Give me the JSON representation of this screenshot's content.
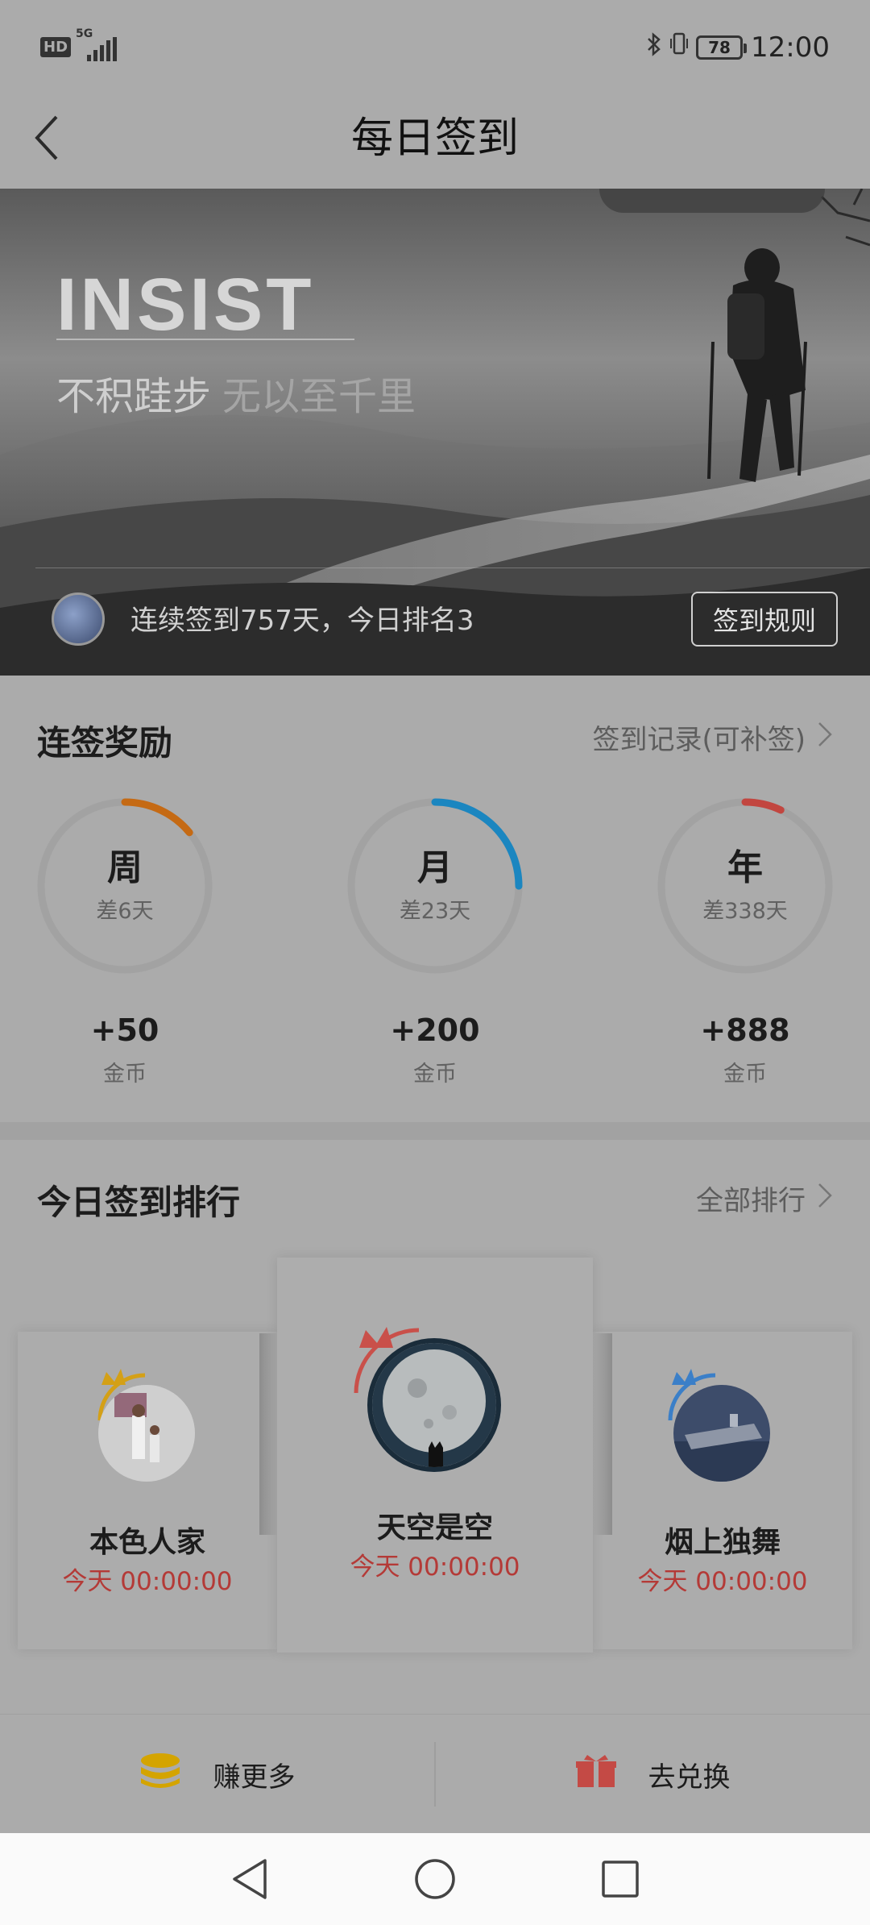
{
  "status_bar": {
    "hd": "HD",
    "network": "5G",
    "battery": "78",
    "time": "12:00"
  },
  "header": {
    "title": "每日签到"
  },
  "banner": {
    "headline": "INSIST",
    "slogan_main": "不积跬步",
    "slogan_rest": "无以至千里",
    "streak_text": "连续签到757天，今日排名3",
    "rules_button": "签到规则"
  },
  "rewards": {
    "title": "连签奖励",
    "link": "签到记录(可补签)",
    "items": [
      {
        "label": "周",
        "remaining": "差6天",
        "amount": "+50",
        "unit": "金币",
        "progress": 0.14,
        "color": "#c56a14"
      },
      {
        "label": "月",
        "remaining": "差23天",
        "amount": "+200",
        "unit": "金币",
        "progress": 0.25,
        "color": "#1b86c0"
      },
      {
        "label": "年",
        "remaining": "差338天",
        "amount": "+888",
        "unit": "金币",
        "progress": 0.07,
        "color": "#c24640"
      }
    ]
  },
  "ranking": {
    "title": "今日签到排行",
    "link": "全部排行",
    "entries": [
      {
        "rank": 2,
        "name": "本色人家",
        "time": "今天 00:00:00",
        "crown_color": "#d4a017"
      },
      {
        "rank": 1,
        "name": "天空是空",
        "time": "今天 00:00:00",
        "crown_color": "#c9504a"
      },
      {
        "rank": 3,
        "name": "烟上独舞",
        "time": "今天 00:00:00",
        "crown_color": "#3b7fc8"
      }
    ]
  },
  "actions": {
    "earn_more": "赚更多",
    "exchange": "去兑换"
  },
  "colors": {
    "accent_red": "#b43a37",
    "coin_yellow": "#d4a400",
    "gift_red": "#c44a45"
  }
}
